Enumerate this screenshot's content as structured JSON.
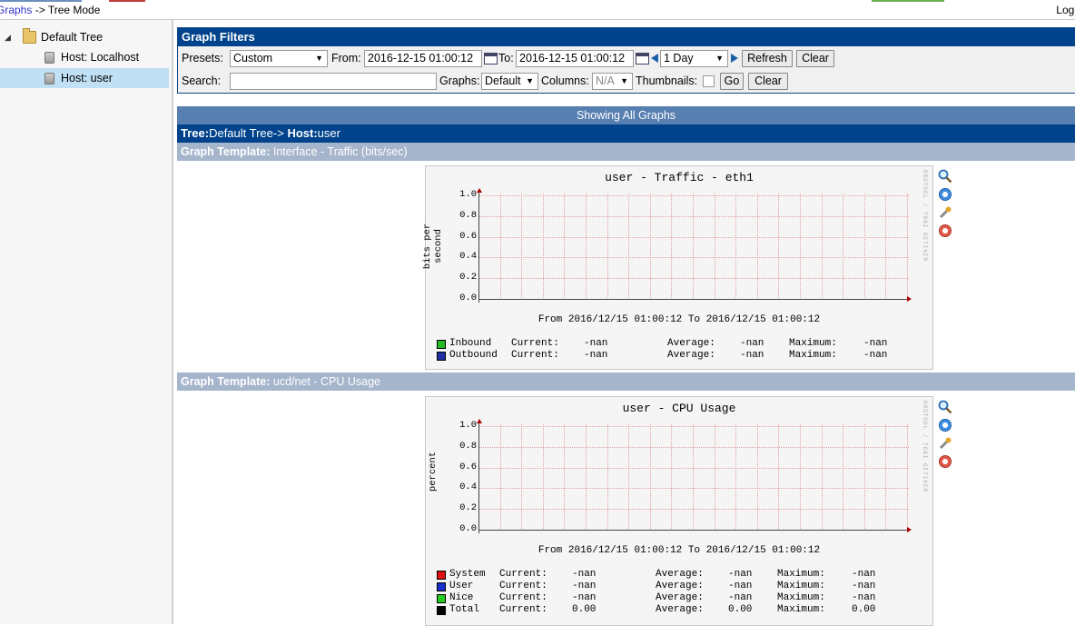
{
  "header": {
    "breadcrumb_link": "Graphs",
    "breadcrumb_rest": " -> Tree Mode",
    "logout": "Logo"
  },
  "tree": {
    "root": "Default Tree",
    "items": [
      {
        "label": "Host: Localhost"
      },
      {
        "label": "Host: user"
      }
    ]
  },
  "filters": {
    "title": "Graph Filters",
    "presets_label": "Presets:",
    "presets_value": "Custom",
    "from_label": "From:",
    "from_value": "2016-12-15 01:00:12",
    "to_label": "To:",
    "to_value": "2016-12-15 01:00:12",
    "timespan_value": "1 Day",
    "refresh": "Refresh",
    "clear": "Clear",
    "search_label": "Search:",
    "search_value": "",
    "graphs_label": "Graphs:",
    "graphs_value": "Default",
    "columns_label": "Columns:",
    "columns_value": "N/A",
    "thumbnails_label": "Thumbnails:",
    "go": "Go",
    "clear2": "Clear"
  },
  "showing": "Showing All Graphs",
  "tree_bar": {
    "tree_label": "Tree:",
    "tree_value": "Default Tree->",
    "host_label": " Host:",
    "host_value": "user"
  },
  "templates": [
    {
      "label": "Graph Template:",
      "value": " Interface - Traffic (bits/sec)"
    },
    {
      "label": "Graph Template:",
      "value": " ucd/net - CPU Usage"
    }
  ],
  "graphs": [
    {
      "title": "user - Traffic - eth1",
      "ylabel": "bits per second",
      "fromto": "From 2016/12/15 01:00:12 To 2016/12/15 01:00:12",
      "side_text": "RRDTOOL / TOBI OETIKER",
      "legend": [
        {
          "name": "Inbound",
          "color": "#22bb22",
          "current": "-nan",
          "average": "-nan",
          "maximum": "-nan"
        },
        {
          "name": "Outbound",
          "color": "#1f2f9f",
          "current": "-nan",
          "average": "-nan",
          "maximum": "-nan"
        }
      ]
    },
    {
      "title": "user - CPU Usage",
      "ylabel": "percent",
      "fromto": "From 2016/12/15 01:00:12 To 2016/12/15 01:00:12",
      "side_text": "RRDTOOL / TOBI OETIKER",
      "legend": [
        {
          "name": "System",
          "color": "#dd1111",
          "current": "-nan",
          "average": "-nan",
          "maximum": "-nan"
        },
        {
          "name": "User",
          "color": "#1a2fcc",
          "current": "-nan",
          "average": "-nan",
          "maximum": "-nan"
        },
        {
          "name": "Nice",
          "color": "#22cc22",
          "current": "-nan",
          "average": "-nan",
          "maximum": "-nan"
        },
        {
          "name": "Total",
          "color": "#000000",
          "current": "0.00",
          "average": "0.00",
          "maximum": "0.00"
        }
      ]
    }
  ],
  "legend_labels": {
    "current": "Current:",
    "average": "Average:",
    "maximum": "Maximum:"
  },
  "y_ticks": [
    "1.0",
    "0.8",
    "0.6",
    "0.4",
    "0.2",
    "0.0"
  ],
  "icons": [
    "zoom-icon",
    "info-icon",
    "edit-icon",
    "export-icon"
  ]
}
